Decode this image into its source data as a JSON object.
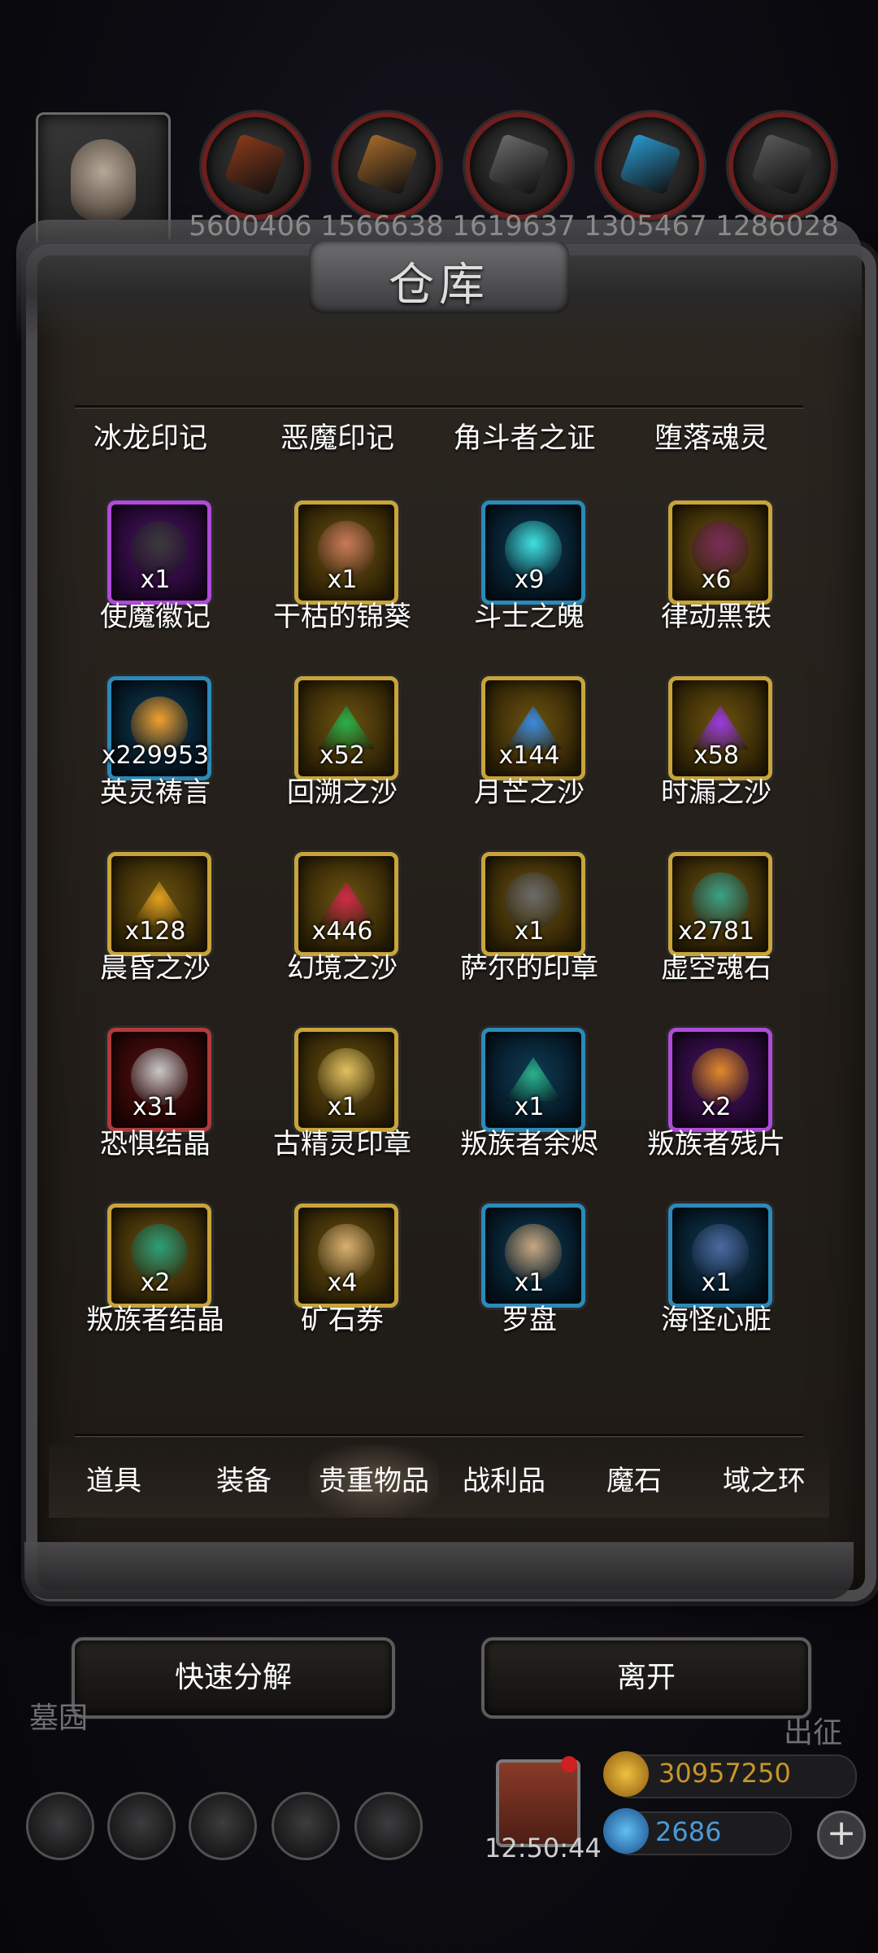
{
  "resources": [
    {
      "icon": "meat-icon",
      "value": "5600406",
      "color": "#8a3a1a"
    },
    {
      "icon": "wood-icon",
      "value": "1566638",
      "color": "#a5692a"
    },
    {
      "icon": "stone-icon",
      "value": "1619637",
      "color": "#6a6a6a"
    },
    {
      "icon": "crystal-icon",
      "value": "1305467",
      "color": "#2a9ad0"
    },
    {
      "icon": "iron-icon",
      "value": "1286028",
      "color": "#5a5a5a"
    }
  ],
  "panel": {
    "title": "仓库",
    "top_row_labels": [
      "冰龙印记",
      "恶魔印记",
      "角斗者之证",
      "堕落魂灵"
    ]
  },
  "items": [
    {
      "name": "使魔徽记",
      "count": "x1",
      "frame": "purple",
      "art": "#3a3a3a"
    },
    {
      "name": "干枯的锦葵",
      "count": "x1",
      "frame": "gold",
      "art": "#c87a5a"
    },
    {
      "name": "斗士之魄",
      "count": "x9",
      "frame": "blue",
      "art": "#40e0e0"
    },
    {
      "name": "律动黑铁",
      "count": "x6",
      "frame": "gold",
      "art": "#7a2a5a"
    },
    {
      "name": "英灵祷言",
      "count": "x229953",
      "frame": "blue",
      "art": "#f0a030"
    },
    {
      "name": "回溯之沙",
      "count": "x52",
      "frame": "gold",
      "art": "#2ab04a"
    },
    {
      "name": "月芒之沙",
      "count": "x144",
      "frame": "gold",
      "art": "#3a8ae0"
    },
    {
      "name": "时漏之沙",
      "count": "x58",
      "frame": "gold",
      "art": "#9a3ae0"
    },
    {
      "name": "晨昏之沙",
      "count": "x128",
      "frame": "gold",
      "art": "#e0a020"
    },
    {
      "name": "幻境之沙",
      "count": "x446",
      "frame": "gold",
      "art": "#d02a4a"
    },
    {
      "name": "萨尔的印章",
      "count": "x1",
      "frame": "gold",
      "art": "#6a6a6a"
    },
    {
      "name": "虚空魂石",
      "count": "x2781",
      "frame": "gold",
      "art": "#3aa08a"
    },
    {
      "name": "恐惧结晶",
      "count": "x31",
      "frame": "red",
      "art": "#c8c8c8"
    },
    {
      "name": "古精灵印章",
      "count": "x1",
      "frame": "gold",
      "art": "#e0c060"
    },
    {
      "name": "叛族者余烬",
      "count": "x1",
      "frame": "blue",
      "art": "#2ab08a"
    },
    {
      "name": "叛族者残片",
      "count": "x2",
      "frame": "purple",
      "art": "#e08a2a"
    },
    {
      "name": "叛族者结晶",
      "count": "x2",
      "frame": "gold",
      "art": "#2aa07a"
    },
    {
      "name": "矿石券",
      "count": "x4",
      "frame": "gold",
      "art": "#d8b070"
    },
    {
      "name": "罗盘",
      "count": "x1",
      "frame": "blue",
      "art": "#c8a880"
    },
    {
      "name": "海怪心脏",
      "count": "x1",
      "frame": "blue",
      "art": "#4a6aa0"
    }
  ],
  "tabs": [
    "道具",
    "装备",
    "贵重物品",
    "战利品",
    "魔石",
    "域之环"
  ],
  "active_tab": "贵重物品",
  "buttons": {
    "decompose": "快速分解",
    "leave": "离开"
  },
  "background_labels": {
    "left": "墓园",
    "right": "出征"
  },
  "bottom_bar": {
    "time": "12:50:44",
    "gold": "30957250",
    "gems": "2686",
    "icons": [
      "settings-icon",
      "star-icon",
      "hall-icon",
      "mail-icon",
      "guild-icon"
    ]
  }
}
